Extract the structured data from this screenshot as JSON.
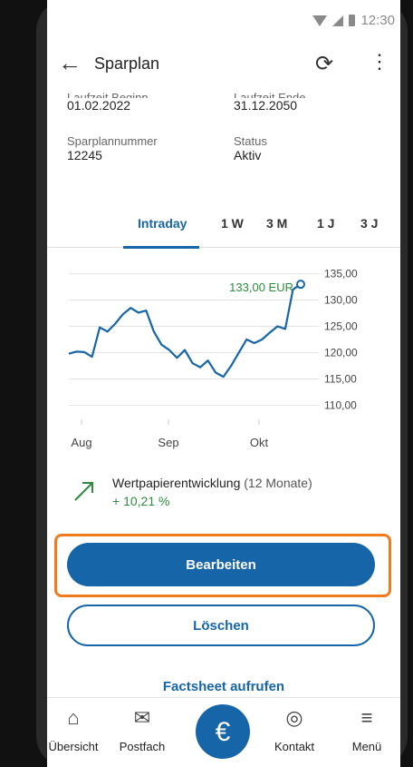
{
  "status_bar": {
    "time": "12:30"
  },
  "app_bar": {
    "title": "Sparplan"
  },
  "info": {
    "laufzeit_beginn_label": "Laufzeit Beginn",
    "laufzeit_beginn_value": "01.02.2022",
    "laufzeit_ende_label": "Laufzeit Ende",
    "laufzeit_ende_value": "31.12.2050",
    "sparplannummer_label": "Sparplannummer",
    "sparplannummer_value": "12245",
    "status_label": "Status",
    "status_value": "Aktiv"
  },
  "tabs": [
    "Intraday",
    "1 W",
    "3 M",
    "1 J",
    "3 J"
  ],
  "chart_data": {
    "type": "line",
    "current_label": "133,00 EUR",
    "x_ticks": [
      "Aug",
      "Sep",
      "Okt"
    ],
    "y_ticks": [
      "135,00",
      "130,00",
      "125,00",
      "120,00",
      "115,00",
      "110,00"
    ],
    "ylim": [
      108,
      137
    ],
    "values": [
      119.8,
      120.2,
      120.1,
      119.2,
      124.8,
      124.0,
      125.5,
      127.3,
      128.5,
      127.6,
      128.0,
      124.0,
      121.5,
      120.5,
      119.0,
      120.5,
      118.0,
      117.2,
      118.5,
      116.2,
      115.4,
      117.5,
      120.0,
      122.5,
      121.8,
      122.5,
      123.8,
      125.0,
      124.5,
      132.0,
      133.0
    ]
  },
  "performance": {
    "label": "Wertpapierentwicklung",
    "period": "(12 Monate)",
    "value": "+ 10,21 %"
  },
  "actions": {
    "edit": "Bearbeiten",
    "delete": "Löschen",
    "factsheet": "Factsheet aufrufen"
  },
  "bottom_nav": {
    "overview": "Übersicht",
    "inbox": "Postfach",
    "euro": "€",
    "contact": "Kontakt",
    "menu": "Menü"
  },
  "colors": {
    "accent": "#1565a8",
    "positive": "#2e8b3d",
    "highlight": "#f07a1e"
  }
}
